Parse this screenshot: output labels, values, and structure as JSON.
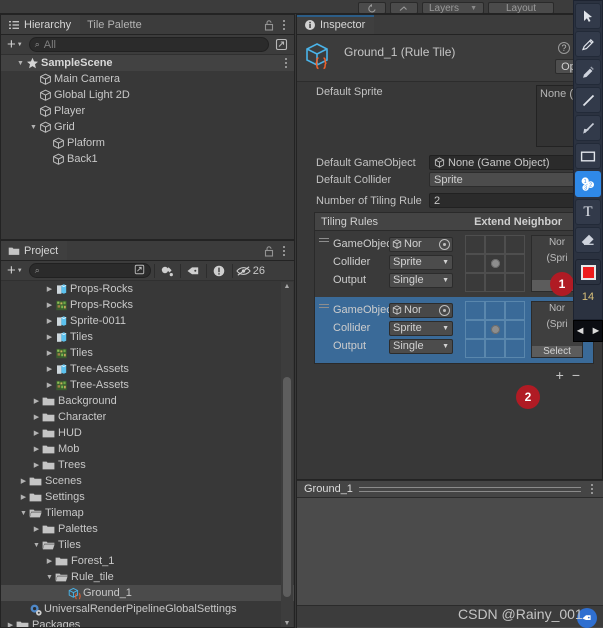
{
  "top_toolbar": {
    "buttons": [
      "undo-icon",
      "hand-icon"
    ],
    "layers_label": "Layers",
    "layout_label": "Layout"
  },
  "hierarchy": {
    "tabs": [
      {
        "label": "Hierarchy",
        "icon": "hierarchy-icon",
        "active": true
      },
      {
        "label": "Tile Palette",
        "icon": "",
        "active": false
      }
    ],
    "lock_icon": "lock-icon",
    "menu_icon": "kebab-icon",
    "toolbar": {
      "add_label": "+",
      "search_placeholder": "All",
      "search_value": ""
    },
    "items": [
      {
        "label": "SampleScene",
        "depth": 1,
        "arrow": "down",
        "icon": "scene-icon",
        "bold": true,
        "selected": false
      },
      {
        "label": "Main Camera",
        "depth": 2,
        "arrow": "",
        "icon": "gameobject-icon",
        "bold": false,
        "selected": false
      },
      {
        "label": "Global Light 2D",
        "depth": 2,
        "arrow": "",
        "icon": "gameobject-icon",
        "bold": false,
        "selected": false
      },
      {
        "label": "Player",
        "depth": 2,
        "arrow": "",
        "icon": "gameobject-icon",
        "bold": false,
        "selected": false
      },
      {
        "label": "Grid",
        "depth": 2,
        "arrow": "down",
        "icon": "gameobject-icon",
        "bold": false,
        "selected": false
      },
      {
        "label": "Plaform",
        "depth": 3,
        "arrow": "",
        "icon": "gameobject-icon",
        "bold": false,
        "selected": false
      },
      {
        "label": "Back1",
        "depth": 3,
        "arrow": "",
        "icon": "gameobject-icon",
        "bold": false,
        "selected": false
      }
    ]
  },
  "project": {
    "tabs": [
      {
        "label": "Project",
        "icon": "folder-icon",
        "active": true
      }
    ],
    "lock_icon": "lock-icon",
    "menu_icon": "kebab-icon",
    "toolbar": {
      "add_label": "+",
      "search_placeholder": "",
      "search_value": "",
      "icons": [
        "paint-filter-icon",
        "label-filter-icon",
        "warning-filter-icon",
        "hidden-eye-icon"
      ],
      "hidden_count": "26"
    },
    "items": [
      {
        "label": "Props-Rocks",
        "depth": 4,
        "arrow": "right",
        "icon": "prefab-icon",
        "selected": false
      },
      {
        "label": "Props-Rocks",
        "depth": 4,
        "arrow": "right",
        "icon": "texture-icon",
        "selected": false
      },
      {
        "label": "Sprite-0011",
        "depth": 4,
        "arrow": "right",
        "icon": "prefab-icon",
        "selected": false
      },
      {
        "label": "Tiles",
        "depth": 4,
        "arrow": "right",
        "icon": "prefab-icon",
        "selected": false
      },
      {
        "label": "Tiles",
        "depth": 4,
        "arrow": "right",
        "icon": "texture-icon",
        "selected": false
      },
      {
        "label": "Tree-Assets",
        "depth": 4,
        "arrow": "right",
        "icon": "prefab-icon",
        "selected": false
      },
      {
        "label": "Tree-Assets",
        "depth": 4,
        "arrow": "right",
        "icon": "texture-icon",
        "selected": false
      },
      {
        "label": "Background",
        "depth": 3,
        "arrow": "right",
        "icon": "folder-icon",
        "selected": false
      },
      {
        "label": "Character",
        "depth": 3,
        "arrow": "right",
        "icon": "folder-icon",
        "selected": false
      },
      {
        "label": "HUD",
        "depth": 3,
        "arrow": "right",
        "icon": "folder-icon",
        "selected": false
      },
      {
        "label": "Mob",
        "depth": 3,
        "arrow": "right",
        "icon": "folder-icon",
        "selected": false
      },
      {
        "label": "Trees",
        "depth": 3,
        "arrow": "right",
        "icon": "folder-icon",
        "selected": false
      },
      {
        "label": "Scenes",
        "depth": 2,
        "arrow": "right",
        "icon": "folder-icon",
        "selected": false
      },
      {
        "label": "Settings",
        "depth": 2,
        "arrow": "right",
        "icon": "folder-icon",
        "selected": false
      },
      {
        "label": "Tilemap",
        "depth": 2,
        "arrow": "down",
        "icon": "folder-open-icon",
        "selected": false
      },
      {
        "label": "Palettes",
        "depth": 3,
        "arrow": "right",
        "icon": "folder-icon",
        "selected": false
      },
      {
        "label": "Tiles",
        "depth": 3,
        "arrow": "down",
        "icon": "folder-open-icon",
        "selected": false
      },
      {
        "label": "Forest_1",
        "depth": 4,
        "arrow": "right",
        "icon": "folder-icon",
        "selected": false
      },
      {
        "label": "Rule_tile",
        "depth": 4,
        "arrow": "down",
        "icon": "folder-open-icon",
        "selected": false
      },
      {
        "label": "Ground_1",
        "depth": 5,
        "arrow": "",
        "icon": "ruletile-icon",
        "selected": true
      },
      {
        "label": "UniversalRenderPipelineGlobalSettings",
        "depth": 2,
        "arrow": "",
        "icon": "settings-asset-icon",
        "selected": false
      },
      {
        "label": "Packages",
        "depth": 1,
        "arrow": "right",
        "icon": "folder-icon",
        "selected": false
      }
    ]
  },
  "inspector": {
    "tab_label": "Inspector",
    "tab_icon": "info-icon",
    "asset_title": "Ground_1 (Rule Tile)",
    "asset_icon": "ruletile-icon",
    "help_icon": "help-icon",
    "open_button": "Open",
    "properties": {
      "default_sprite_label": "Default Sprite",
      "default_sprite_value": "None (",
      "default_gameobject_label": "Default GameObject",
      "default_gameobject_value": "None (Game Object)",
      "default_collider_label": "Default Collider",
      "default_collider_value": "Sprite",
      "number_of_tiling_rules_label": "Number of Tiling Rule",
      "number_of_tiling_rules_value": "2"
    },
    "tiling_rules": {
      "header_left": "Tiling Rules",
      "header_right": "Extend Neighbor",
      "rules": [
        {
          "gameobject_label": "GameObject",
          "gameobject_value": "Nor",
          "collider_label": "Collider",
          "collider_value": "Sprite",
          "output_label": "Output",
          "output_value": "Single",
          "sprite_value": "Nor",
          "sprite_sub": "(Spri",
          "select_label": "Se",
          "selected": false
        },
        {
          "gameobject_label": "GameObject",
          "gameobject_value": "Nor",
          "collider_label": "Collider",
          "collider_value": "Sprite",
          "output_label": "Output",
          "output_value": "Single",
          "sprite_value": "Nor",
          "sprite_sub": "(Spri",
          "select_label": "Select",
          "selected": true
        }
      ],
      "add_label": "+",
      "remove_label": "−"
    }
  },
  "preview": {
    "title": "Ground_1",
    "menu_icon": "kebab-icon"
  },
  "annotations": {
    "badges": [
      {
        "label": "1"
      },
      {
        "label": "2"
      }
    ],
    "toolbar": {
      "tools": [
        {
          "name": "cursor-icon",
          "active": false
        },
        {
          "name": "pencil-icon",
          "active": false
        },
        {
          "name": "marker-icon",
          "active": false
        },
        {
          "name": "line-icon",
          "active": false
        },
        {
          "name": "arrow-icon",
          "active": false
        },
        {
          "name": "rectangle-icon",
          "active": false
        },
        {
          "name": "step-number-icon",
          "active": true
        },
        {
          "name": "text-icon",
          "active": false
        },
        {
          "name": "eraser-icon",
          "active": false
        }
      ],
      "color_swatch": "#ee1c1c",
      "stroke_size": "14",
      "nav_prev": "◄",
      "nav_next": "►"
    }
  },
  "watermark": {
    "text": "CSDN @Rainy_001",
    "badge_icon": "tag-icon"
  },
  "colors": {
    "panel_bg": "#383838",
    "header_bg": "#3c3c3c",
    "selection_blue": "#3a6a98",
    "accent_blue": "#2f89e8",
    "badge_red": "#b01b24",
    "toolbar_navy": "#2b3240"
  }
}
